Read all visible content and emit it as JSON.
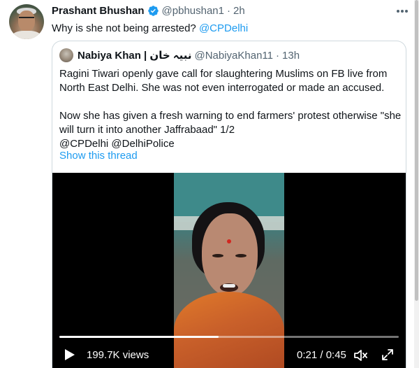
{
  "tweet": {
    "author_name": "Prashant Bhushan",
    "handle": "@pbhushan1",
    "separator": "·",
    "time": "2h",
    "text": "Why is she not being arrested? ",
    "mention": "@CPDelhi",
    "verified": true,
    "more_icon": "more-dots-icon"
  },
  "quote": {
    "author_name": "Nabiya Khan | نبیہ خان",
    "handle": "@NabiyaKhan11",
    "separator": "·",
    "time": "13h",
    "lines": [
      "Ragini Tiwari openly gave call for slaughtering Muslims on FB live from",
      "North East Delhi. She  was not even interrogated or made an accused."
    ],
    "lines2": [
      "Now she has given a fresh warning to end farmers' protest otherwise \"she",
      "will turn it into another Jaffrabaad\" 1/2"
    ],
    "mentions": "@CPDelhi @DelhiPolice",
    "show_thread": "Show this thread"
  },
  "video": {
    "views": "199.7K views",
    "timer": "0:21 / 0:45",
    "progress": 0.47,
    "icons": [
      "play-icon",
      "mute-icon",
      "fullscreen-icon"
    ]
  },
  "colors": {
    "accent": "#1d9bf0",
    "text": "#0f1419",
    "muted": "#536471",
    "border": "#cfd9de"
  }
}
